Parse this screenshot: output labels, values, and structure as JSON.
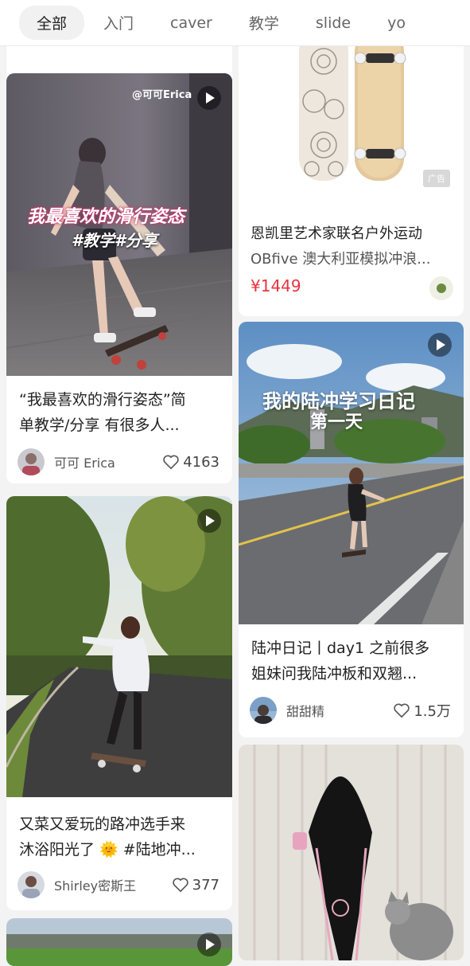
{
  "tabs": [
    "全部",
    "入门",
    "caver",
    "教学",
    "slide",
    "yo"
  ],
  "cards": {
    "top_left_partial": {
      "author": "",
      "likes": ""
    },
    "erica": {
      "overlay_handle": "@可可Erica",
      "overlay_line1": "我最喜欢的滑行姿态",
      "overlay_line2": "#教学#分享",
      "title_line1": "“我最喜欢的滑行姿态”简",
      "title_line2": "单教学/分享 有很多人...",
      "author": "可可 Erica",
      "likes": "4163"
    },
    "ad": {
      "badge": "广告",
      "title": "恩凯里艺术家联名户外运动",
      "subtitle": "OBfive 澳大利亚模拟冲浪...",
      "price": "¥1449"
    },
    "diary": {
      "overlay_line1": "我的陆冲学习日记",
      "overlay_line2": "第一天",
      "title_line1": "陆冲日记丨day1 之前很多",
      "title_line2": "姐妹问我陆冲板和双翘...",
      "author": "甜甜精",
      "likes": "1.5万"
    },
    "shirley": {
      "title_line1": "又菜又爱玩的路冲选手来",
      "title_line2": "沐浴阳光了 🌞 #陆地冲...",
      "author": "Shirley密斯王",
      "likes": "377"
    }
  },
  "colors": {
    "price": "#e8333f",
    "tab_active_bg": "#f1f1f1",
    "page_bg": "#f3f3f3"
  }
}
